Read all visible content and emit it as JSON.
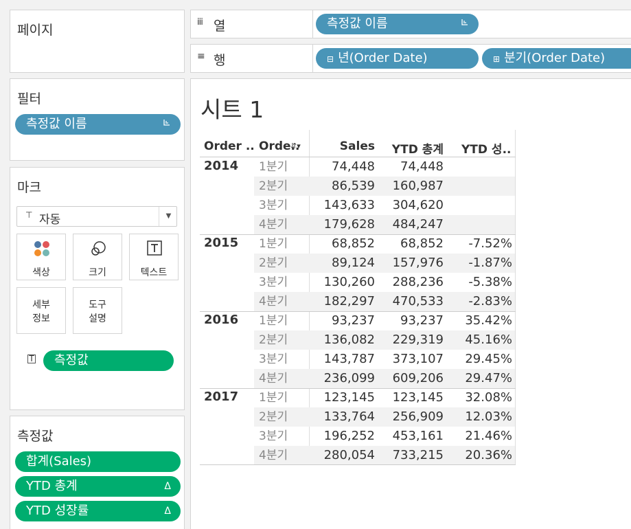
{
  "pages_panel": {
    "title": "페이지"
  },
  "filters_panel": {
    "title": "필터",
    "pills": [
      {
        "label": "측정값 이름"
      }
    ]
  },
  "marks_panel": {
    "title": "마크",
    "mark_type": "자동",
    "cards": [
      {
        "label": "색상",
        "icon": "color-icon"
      },
      {
        "label": "크기",
        "icon": "size-icon"
      },
      {
        "label": "텍스트",
        "icon": "text-icon"
      },
      {
        "label": "세부\n정보",
        "line1": "세부",
        "line2": "정보",
        "icon": "detail-icon"
      },
      {
        "label": "도구\n설명",
        "line1": "도구",
        "line2": "설명",
        "icon": "tooltip-icon"
      }
    ],
    "field_pill": "측정값"
  },
  "measure_values_panel": {
    "title": "측정값",
    "pills": [
      {
        "label": "합계(Sales)",
        "delta": ""
      },
      {
        "label": "YTD 총계",
        "delta": "Δ"
      },
      {
        "label": "YTD 성장률",
        "delta": "Δ"
      }
    ]
  },
  "columns_shelf": {
    "label": "열",
    "pills": [
      {
        "label": "측정값 이름"
      }
    ]
  },
  "rows_shelf": {
    "label": "행",
    "pills": [
      {
        "label": "년(Order Date)"
      },
      {
        "label": "분기(Order Date)"
      }
    ]
  },
  "sheet": {
    "title": "시트 1"
  },
  "table": {
    "headers": [
      "Order ..",
      "Orde..",
      "Sales",
      "YTD 총계",
      "YTD 성.."
    ],
    "groups": [
      {
        "year": "2014",
        "rows": [
          {
            "quarter": "1분기",
            "sales": "74,448",
            "ytd_total": "74,448",
            "ytd_growth": ""
          },
          {
            "quarter": "2분기",
            "sales": "86,539",
            "ytd_total": "160,987",
            "ytd_growth": ""
          },
          {
            "quarter": "3분기",
            "sales": "143,633",
            "ytd_total": "304,620",
            "ytd_growth": ""
          },
          {
            "quarter": "4분기",
            "sales": "179,628",
            "ytd_total": "484,247",
            "ytd_growth": ""
          }
        ]
      },
      {
        "year": "2015",
        "rows": [
          {
            "quarter": "1분기",
            "sales": "68,852",
            "ytd_total": "68,852",
            "ytd_growth": "-7.52%"
          },
          {
            "quarter": "2분기",
            "sales": "89,124",
            "ytd_total": "157,976",
            "ytd_growth": "-1.87%"
          },
          {
            "quarter": "3분기",
            "sales": "130,260",
            "ytd_total": "288,236",
            "ytd_growth": "-5.38%"
          },
          {
            "quarter": "4분기",
            "sales": "182,297",
            "ytd_total": "470,533",
            "ytd_growth": "-2.83%"
          }
        ]
      },
      {
        "year": "2016",
        "rows": [
          {
            "quarter": "1분기",
            "sales": "93,237",
            "ytd_total": "93,237",
            "ytd_growth": "35.42%"
          },
          {
            "quarter": "2분기",
            "sales": "136,082",
            "ytd_total": "229,319",
            "ytd_growth": "45.16%"
          },
          {
            "quarter": "3분기",
            "sales": "143,787",
            "ytd_total": "373,107",
            "ytd_growth": "29.45%"
          },
          {
            "quarter": "4분기",
            "sales": "236,099",
            "ytd_total": "609,206",
            "ytd_growth": "29.47%"
          }
        ]
      },
      {
        "year": "2017",
        "rows": [
          {
            "quarter": "1분기",
            "sales": "123,145",
            "ytd_total": "123,145",
            "ytd_growth": "32.08%"
          },
          {
            "quarter": "2분기",
            "sales": "133,764",
            "ytd_total": "256,909",
            "ytd_growth": "12.03%"
          },
          {
            "quarter": "3분기",
            "sales": "196,252",
            "ytd_total": "453,161",
            "ytd_growth": "21.46%"
          },
          {
            "quarter": "4분기",
            "sales": "280,054",
            "ytd_total": "733,215",
            "ytd_growth": "20.36%"
          }
        ]
      }
    ]
  },
  "colors": {
    "blue_pill": "#4995b8",
    "green_pill": "#00ad6f",
    "band": "#f2f2f2"
  }
}
